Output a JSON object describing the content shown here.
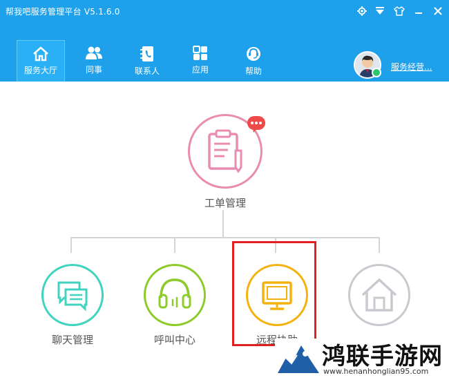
{
  "app": {
    "title": "帮我吧服务管理平台  V5.1.6.0"
  },
  "window_controls": [
    "gear-icon",
    "down-arrow-icon",
    "skin-icon",
    "minimize-icon",
    "close-icon"
  ],
  "nav": [
    {
      "label": "服务大厅",
      "icon": "home-icon",
      "active": true
    },
    {
      "label": "同事",
      "icon": "colleagues-icon"
    },
    {
      "label": "联系人",
      "icon": "contacts-icon"
    },
    {
      "label": "应用",
      "icon": "apps-icon"
    },
    {
      "label": "帮助",
      "icon": "help-icon"
    }
  ],
  "user": {
    "name": "服务经营..."
  },
  "main": {
    "top": {
      "label": "工单管理"
    },
    "children": [
      {
        "label": "聊天管理",
        "color": "#3fd3c0"
      },
      {
        "label": "呼叫中心",
        "color": "#8dcb2a"
      },
      {
        "label": "远程协助",
        "color": "#f4b20e"
      },
      {
        "label": "",
        "color": "#c9c9cf"
      }
    ]
  },
  "watermark": {
    "text": "鸿联手游网",
    "url": "www.henanhonglian95.com"
  },
  "colors": {
    "titlebar": "#1ea0ea",
    "top": "#ea8cb0",
    "highlight": "#e21f1f"
  }
}
